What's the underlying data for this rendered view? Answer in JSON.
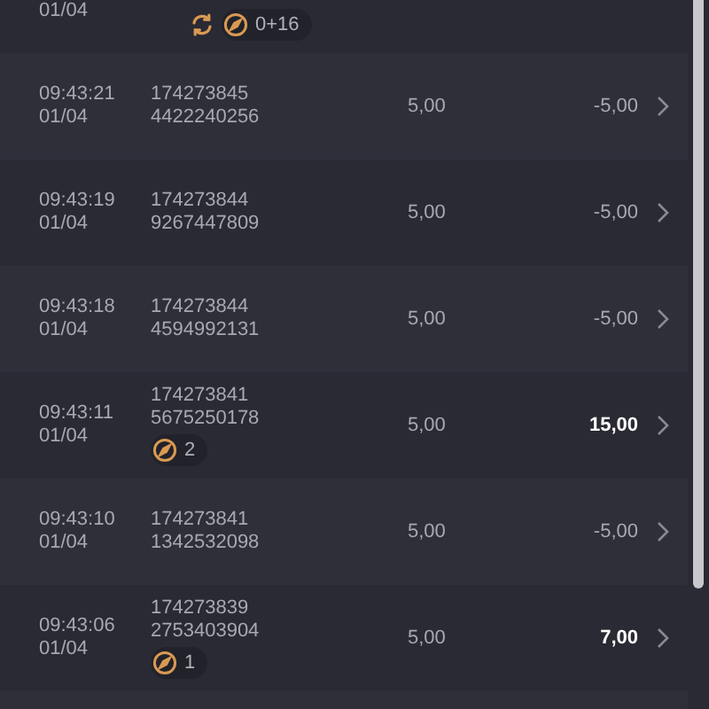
{
  "rows": [
    {
      "date": "01/04",
      "badges": [
        {
          "kind": "refresh"
        },
        {
          "kind": "compass",
          "count": "0+16"
        }
      ]
    },
    {
      "time": "09:43:21",
      "date": "01/04",
      "id_1": "174273845",
      "id_2": "4422240256",
      "stake": "5,00",
      "result": "-5,00",
      "highlight": false,
      "badges": []
    },
    {
      "time": "09:43:19",
      "date": "01/04",
      "id_1": "174273844",
      "id_2": "9267447809",
      "stake": "5,00",
      "result": "-5,00",
      "highlight": false,
      "badges": []
    },
    {
      "time": "09:43:18",
      "date": "01/04",
      "id_1": "174273844",
      "id_2": "4594992131",
      "stake": "5,00",
      "result": "-5,00",
      "highlight": false,
      "badges": []
    },
    {
      "time": "09:43:11",
      "date": "01/04",
      "id_1": "174273841",
      "id_2": "5675250178",
      "stake": "5,00",
      "result": "15,00",
      "highlight": true,
      "badges": [
        {
          "kind": "compass",
          "count": "2"
        }
      ]
    },
    {
      "time": "09:43:10",
      "date": "01/04",
      "id_1": "174273841",
      "id_2": "1342532098",
      "stake": "5,00",
      "result": "-5,00",
      "highlight": false,
      "badges": []
    },
    {
      "time": "09:43:06",
      "date": "01/04",
      "id_1": "174273839",
      "id_2": "2753403904",
      "stake": "5,00",
      "result": "7,00",
      "highlight": true,
      "badges": [
        {
          "kind": "compass",
          "count": "1"
        }
      ]
    }
  ]
}
